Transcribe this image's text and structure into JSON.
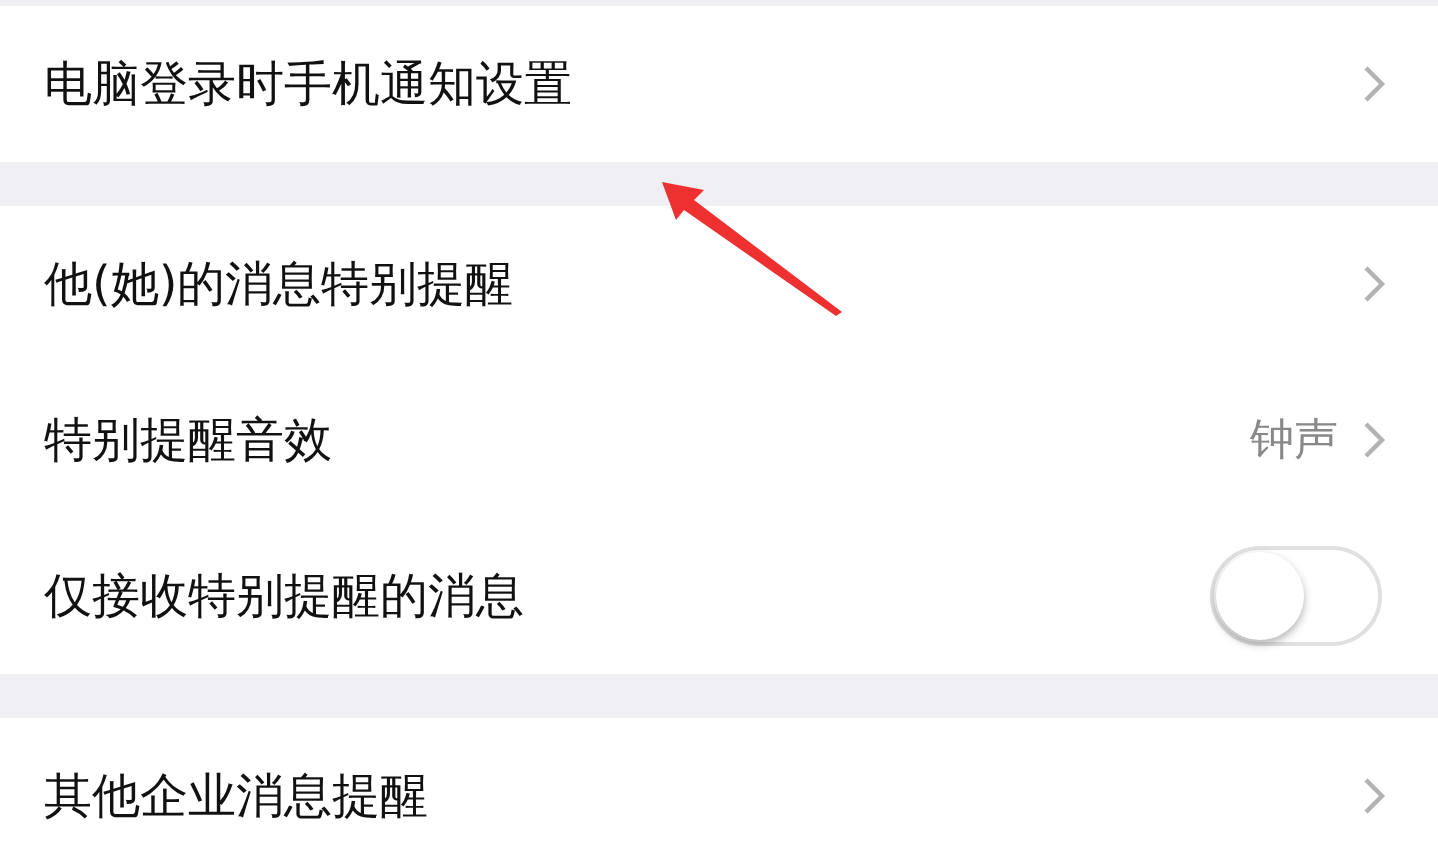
{
  "sections": [
    {
      "rows": [
        {
          "kind": "link",
          "label": "电脑登录时手机通知设置"
        }
      ]
    },
    {
      "rows": [
        {
          "kind": "link",
          "label": "他(她)的消息特别提醒"
        },
        {
          "kind": "link",
          "label": "特别提醒音效",
          "value": "钟声"
        },
        {
          "kind": "toggle",
          "label": "仅接收特别提醒的消息",
          "on": false
        }
      ]
    },
    {
      "rows": [
        {
          "kind": "link",
          "label": "其他企业消息提醒"
        }
      ]
    }
  ]
}
